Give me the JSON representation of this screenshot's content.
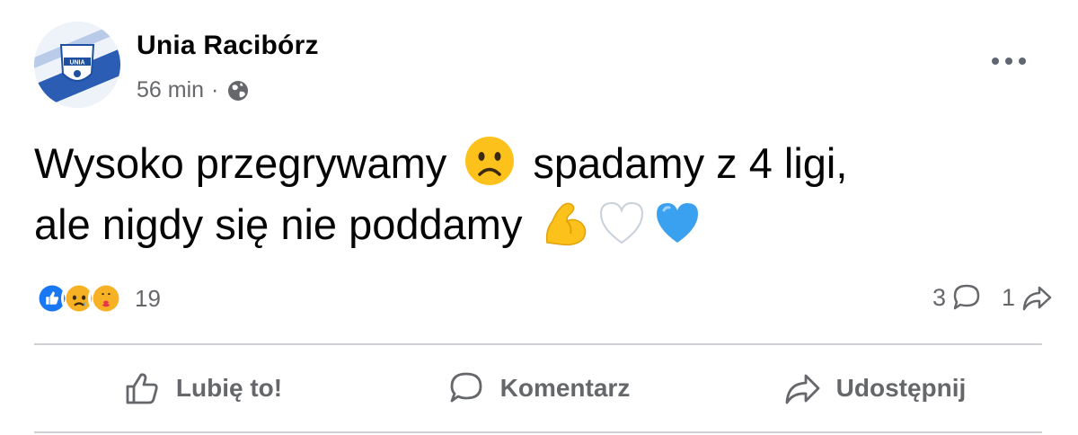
{
  "post": {
    "author": "Unia Racibórz",
    "time": "56 min",
    "separator": "·",
    "audience_icon": "globe-icon",
    "avatar_text": "UNIA",
    "message_parts": {
      "part1": "Wysoko przegrywamy",
      "part2": "spadamy z 4 ligi,",
      "part3": "ale nigdy się nie poddamy"
    },
    "emojis": [
      "sad-face-emoji",
      "flexed-biceps-emoji",
      "white-heart-emoji",
      "blue-heart-emoji"
    ]
  },
  "reactions": {
    "icons": [
      "like-reaction-icon",
      "sad-reaction-icon",
      "care-reaction-icon"
    ],
    "count": "19"
  },
  "counts": {
    "comments": "3",
    "shares": "1"
  },
  "actions": {
    "like": "Lubię to!",
    "comment": "Komentarz",
    "share": "Udostępnij"
  },
  "colors": {
    "accent": "#1877f2",
    "muted": "#65676b",
    "heart_blue": "#3aa0f0"
  }
}
